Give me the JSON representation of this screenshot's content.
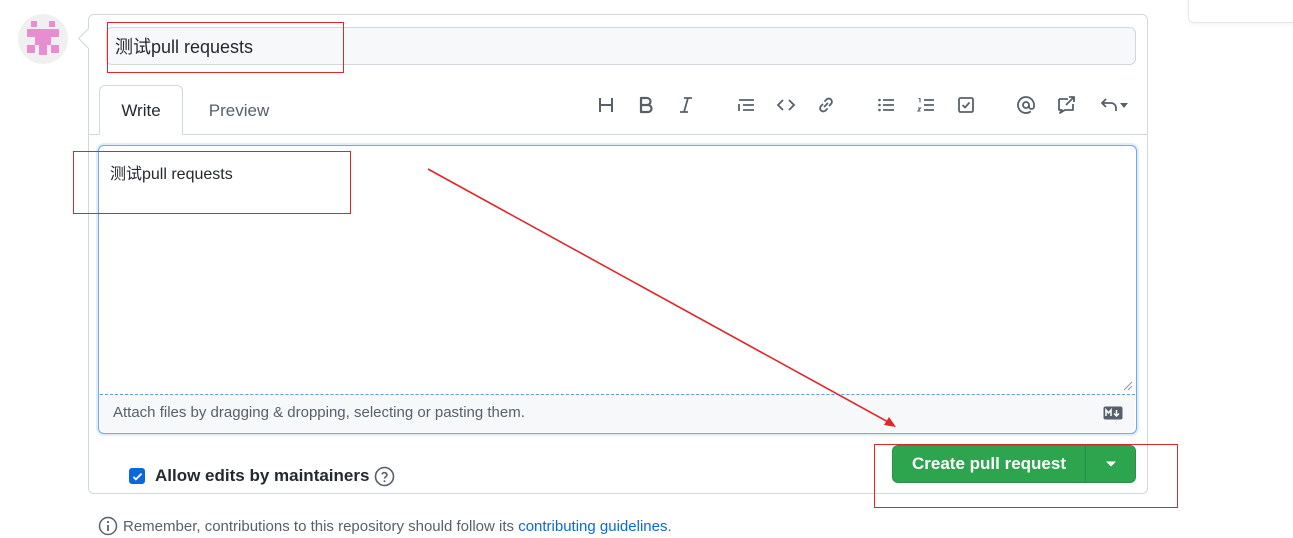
{
  "pull_request": {
    "title_value": "测试pull requests",
    "body_value": "测试pull requests"
  },
  "tabs": {
    "write_label": "Write",
    "preview_label": "Preview"
  },
  "toolbar": {
    "icons": [
      "heading-icon",
      "bold-icon",
      "italic-icon",
      "quote-icon",
      "code-icon",
      "link-icon",
      "bulleted-list-icon",
      "numbered-list-icon",
      "task-list-icon",
      "mention-icon",
      "reference-icon",
      "undo-icon"
    ]
  },
  "attach": {
    "hint": "Attach files by dragging & dropping, selecting or pasting them."
  },
  "options": {
    "allow_edits_label": "Allow edits by maintainers",
    "allow_edits_checked": true
  },
  "actions": {
    "create_label": "Create pull request"
  },
  "footer": {
    "note_prefix": "Remember, contributions to this repository should follow its ",
    "note_link": "contributing guidelines",
    "note_suffix": "."
  },
  "colors": {
    "accent_blue": "#0969da",
    "primary_green": "#2da44e",
    "annotation_red": "#e0262b"
  }
}
